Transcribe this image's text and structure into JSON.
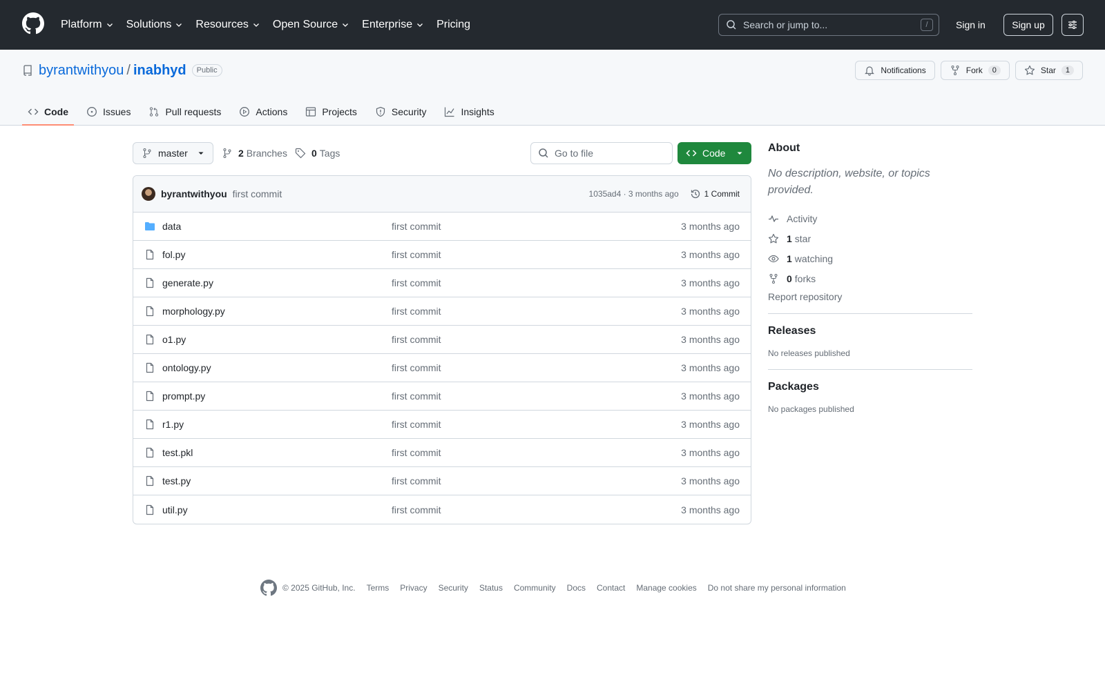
{
  "header": {
    "nav": [
      "Platform",
      "Solutions",
      "Resources",
      "Open Source",
      "Enterprise",
      "Pricing"
    ],
    "search_placeholder": "Search or jump to...",
    "search_key": "/",
    "sign_in": "Sign in",
    "sign_up": "Sign up"
  },
  "repo": {
    "owner": "byrantwithyou",
    "separator": "/",
    "name": "inabhyd",
    "visibility": "Public",
    "notifications_label": "Notifications",
    "fork_label": "Fork",
    "fork_count": "0",
    "star_label": "Star",
    "star_count": "1",
    "tabs": [
      "Code",
      "Issues",
      "Pull requests",
      "Actions",
      "Projects",
      "Security",
      "Insights"
    ]
  },
  "toolbar": {
    "branch": "master",
    "branches_count": "2",
    "branches_label": "Branches",
    "tags_count": "0",
    "tags_label": "Tags",
    "go_to_file": "Go to file",
    "code_button": "Code"
  },
  "commit": {
    "author": "byrantwithyou",
    "message": "first commit",
    "meta": "1035ad4 · 3 months ago",
    "count_label": "1 Commit"
  },
  "files": [
    {
      "name": "data",
      "type": "folder",
      "commit": "first commit",
      "age": "3 months ago"
    },
    {
      "name": "fol.py",
      "type": "file",
      "commit": "first commit",
      "age": "3 months ago"
    },
    {
      "name": "generate.py",
      "type": "file",
      "commit": "first commit",
      "age": "3 months ago"
    },
    {
      "name": "morphology.py",
      "type": "file",
      "commit": "first commit",
      "age": "3 months ago"
    },
    {
      "name": "o1.py",
      "type": "file",
      "commit": "first commit",
      "age": "3 months ago"
    },
    {
      "name": "ontology.py",
      "type": "file",
      "commit": "first commit",
      "age": "3 months ago"
    },
    {
      "name": "prompt.py",
      "type": "file",
      "commit": "first commit",
      "age": "3 months ago"
    },
    {
      "name": "r1.py",
      "type": "file",
      "commit": "first commit",
      "age": "3 months ago"
    },
    {
      "name": "test.pkl",
      "type": "file",
      "commit": "first commit",
      "age": "3 months ago"
    },
    {
      "name": "test.py",
      "type": "file",
      "commit": "first commit",
      "age": "3 months ago"
    },
    {
      "name": "util.py",
      "type": "file",
      "commit": "first commit",
      "age": "3 months ago"
    }
  ],
  "sidebar": {
    "about_title": "About",
    "about_desc": "No description, website, or topics provided.",
    "activity": "Activity",
    "stars_count": "1",
    "stars_label": "star",
    "watching_count": "1",
    "watching_label": "watching",
    "forks_count": "0",
    "forks_label": "forks",
    "report": "Report repository",
    "releases_title": "Releases",
    "releases_empty": "No releases published",
    "packages_title": "Packages",
    "packages_empty": "No packages published"
  },
  "footer": {
    "copyright": "© 2025 GitHub, Inc.",
    "links": [
      "Terms",
      "Privacy",
      "Security",
      "Status",
      "Community",
      "Docs",
      "Contact",
      "Manage cookies",
      "Do not share my personal information"
    ]
  },
  "colors": {
    "header_bg": "#24292f",
    "link": "#0969da",
    "primary_button": "#1f883d",
    "active_tab_underline": "#fd8c73"
  }
}
